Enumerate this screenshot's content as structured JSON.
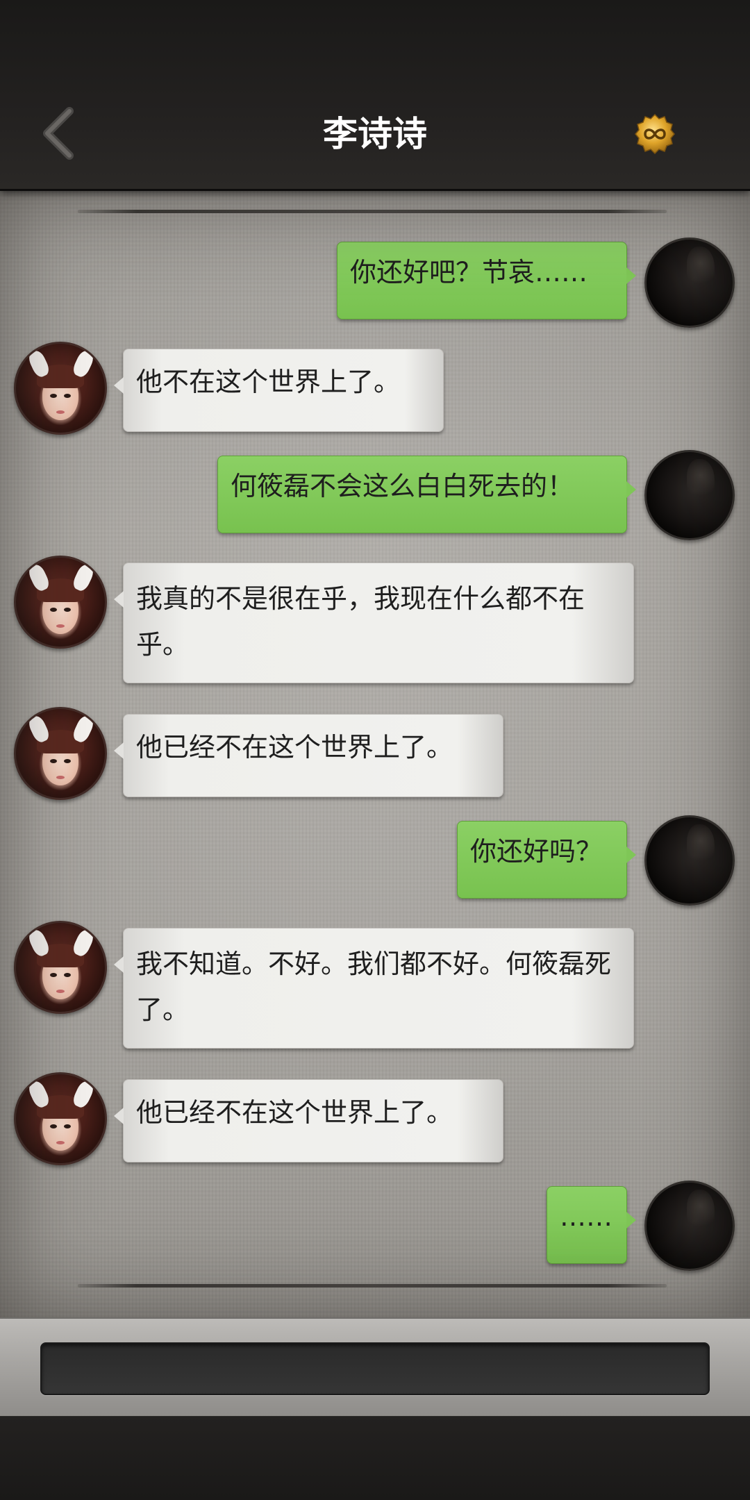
{
  "header": {
    "title": "李诗诗",
    "back_icon": "chevron-left-icon",
    "badge_icon": "infinity-badge-icon",
    "badge_color": "#e0a52a"
  },
  "messages": [
    {
      "from": "user",
      "text": "你还好吧？节哀……"
    },
    {
      "from": "contact",
      "text": "他不在这个世界上了。"
    },
    {
      "from": "user",
      "text": "何筱磊不会这么白白死去的！"
    },
    {
      "from": "contact",
      "text": "我真的不是很在乎，我现在什么都不在乎。"
    },
    {
      "from": "contact",
      "text": "他已经不在这个世界上了。"
    },
    {
      "from": "user",
      "text": "你还好吗？"
    },
    {
      "from": "contact",
      "text": "我不知道。不好。我们都不好。何筱磊死了。"
    },
    {
      "from": "contact",
      "text": "他已经不在这个世界上了。"
    },
    {
      "from": "user",
      "text": "……"
    }
  ],
  "input": {
    "value": "",
    "placeholder": ""
  },
  "colors": {
    "outgoing_bubble": "#7fc657",
    "incoming_bubble": "#efefec",
    "header_bg": "#1f1d1c"
  }
}
